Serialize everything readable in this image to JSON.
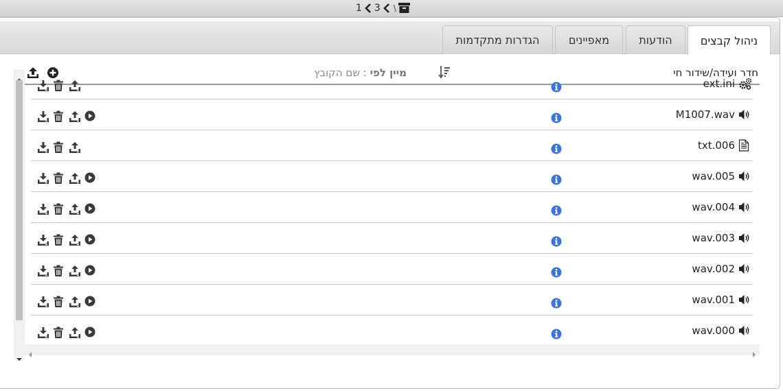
{
  "breadcrumb": {
    "path": [
      "1",
      "3"
    ],
    "separator": "\\"
  },
  "tabs": [
    {
      "label": "ניהול קבצים",
      "active": true
    },
    {
      "label": "הודעות",
      "active": false
    },
    {
      "label": "מאפיינים",
      "active": false
    },
    {
      "label": "הגדרות מתקדמות",
      "active": false
    }
  ],
  "toolbar": {
    "title": "חדר ועידה/שידור חי",
    "sort_label": "מיין לפי",
    "sort_value": ": שם הקובץ"
  },
  "files": [
    {
      "name": "ext.ini",
      "type": "settings-icon",
      "playable": false
    },
    {
      "name": "M1007.wav",
      "type": "speaker-icon",
      "playable": true
    },
    {
      "name": "txt.006",
      "type": "text-file-icon",
      "playable": false
    },
    {
      "name": "wav.005",
      "type": "speaker-icon",
      "playable": true
    },
    {
      "name": "wav.004",
      "type": "speaker-icon",
      "playable": true
    },
    {
      "name": "wav.003",
      "type": "speaker-icon",
      "playable": true
    },
    {
      "name": "wav.002",
      "type": "speaker-icon",
      "playable": true
    },
    {
      "name": "wav.001",
      "type": "speaker-icon",
      "playable": true
    },
    {
      "name": "wav.000",
      "type": "speaker-icon",
      "playable": true
    }
  ],
  "colors": {
    "info": "#3b73e0",
    "icon": "#3a3a3a",
    "text": "#222222"
  }
}
